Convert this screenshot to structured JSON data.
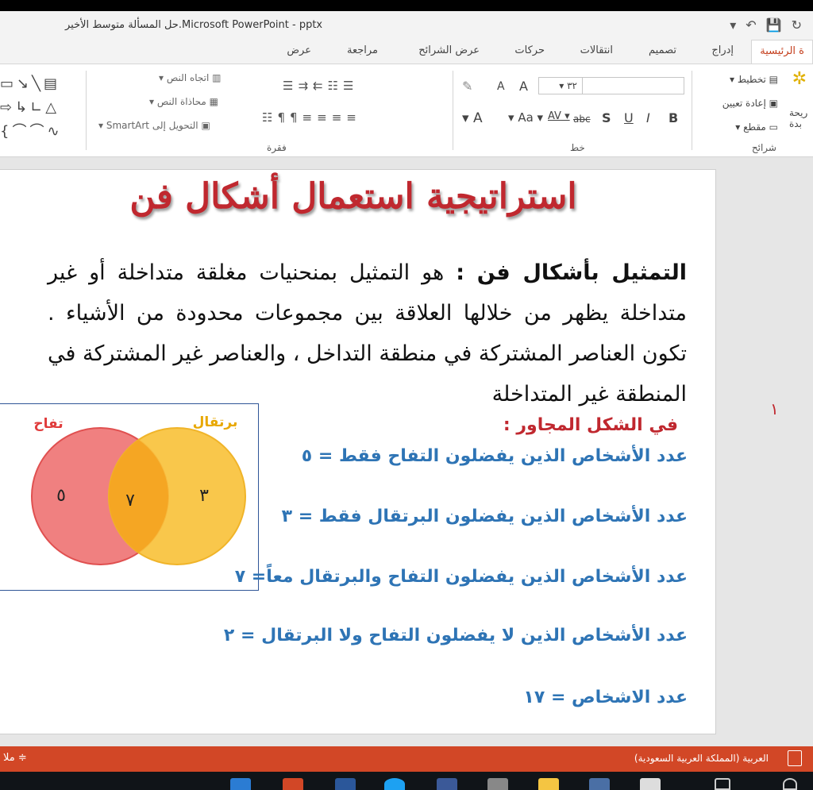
{
  "window": {
    "title": "حل المسألة متوسط الأخير.Microsoft PowerPoint - pptx",
    "undo_icon": "undo-icon",
    "save_icon": "save-icon"
  },
  "tabs": [
    {
      "label": "ة الرئيسية",
      "active": true
    },
    {
      "label": "إدراج"
    },
    {
      "label": "تصميم"
    },
    {
      "label": "انتقالات"
    },
    {
      "label": "حركات"
    },
    {
      "label": "عرض الشرائح"
    },
    {
      "label": "مراجعة"
    },
    {
      "label": "عرض"
    }
  ],
  "ribbon": {
    "slides_group": {
      "label": "شرائح",
      "new_slide": "ريحة",
      "new_slide_2": "بدة",
      "layout": "تخطيط",
      "reset": "إعادة تعيين",
      "section": "مقطع"
    },
    "font_group": {
      "label": "خط",
      "font_size": "٣٢",
      "grow": "A",
      "shrink": "A",
      "bold": "B",
      "italic": "I",
      "underline": "U",
      "shadow": "S",
      "strike": "abc",
      "spacing": "AV",
      "case": "Aa",
      "color": "A"
    },
    "paragraph_group": {
      "label": "فقرة",
      "text_direction": "اتجاه النص",
      "align_text": "محاذاة النص",
      "smartart": "التحويل إلى SmartArt"
    }
  },
  "slide": {
    "title": "استراتيجية استعمال أشكال فن",
    "definition_term": "التمثيل بأشكال فن :",
    "definition_text": " هو التمثيل بمنحنيات مغلقة متداخلة أو غير متداخلة يظهر من خلالها العلاقة بين مجموعات محدودة من الأشياء . تكون العناصر المشتركة في منطقة التداخل ، والعناصر غير المشتركة في المنطقة غير المتداخلة",
    "intro": "في الشكل المجاور :",
    "facts": [
      "عدد الأشخاص الذين يفضلون التفاح فقط = ٥",
      "عدد الأشخاص الذين يفضلون البرتقال فقط = ٣",
      "عدد الأشخاص الذين يفضلون التفاح والبرتقال معاً= ٧",
      "عدد الأشخاص الذين لا يفضلون التفاح ولا البرتقال = ٢",
      "عدد الاشخاص = ١٧"
    ],
    "side_number": "١",
    "venn": {
      "apple_label": "تفاح",
      "orange_label": "برتقال",
      "apple_only": "٥",
      "both": "٧",
      "orange_only": "٣",
      "apple_color": "#f08080",
      "orange_color": "#f9c23c",
      "overlap_color": "#f5a623",
      "label_apple_color": "#e03c3c",
      "label_orange_color": "#e8a800"
    }
  },
  "status": {
    "language": "العربية (المملكة العربية السعودية)",
    "notes": "ملا"
  }
}
